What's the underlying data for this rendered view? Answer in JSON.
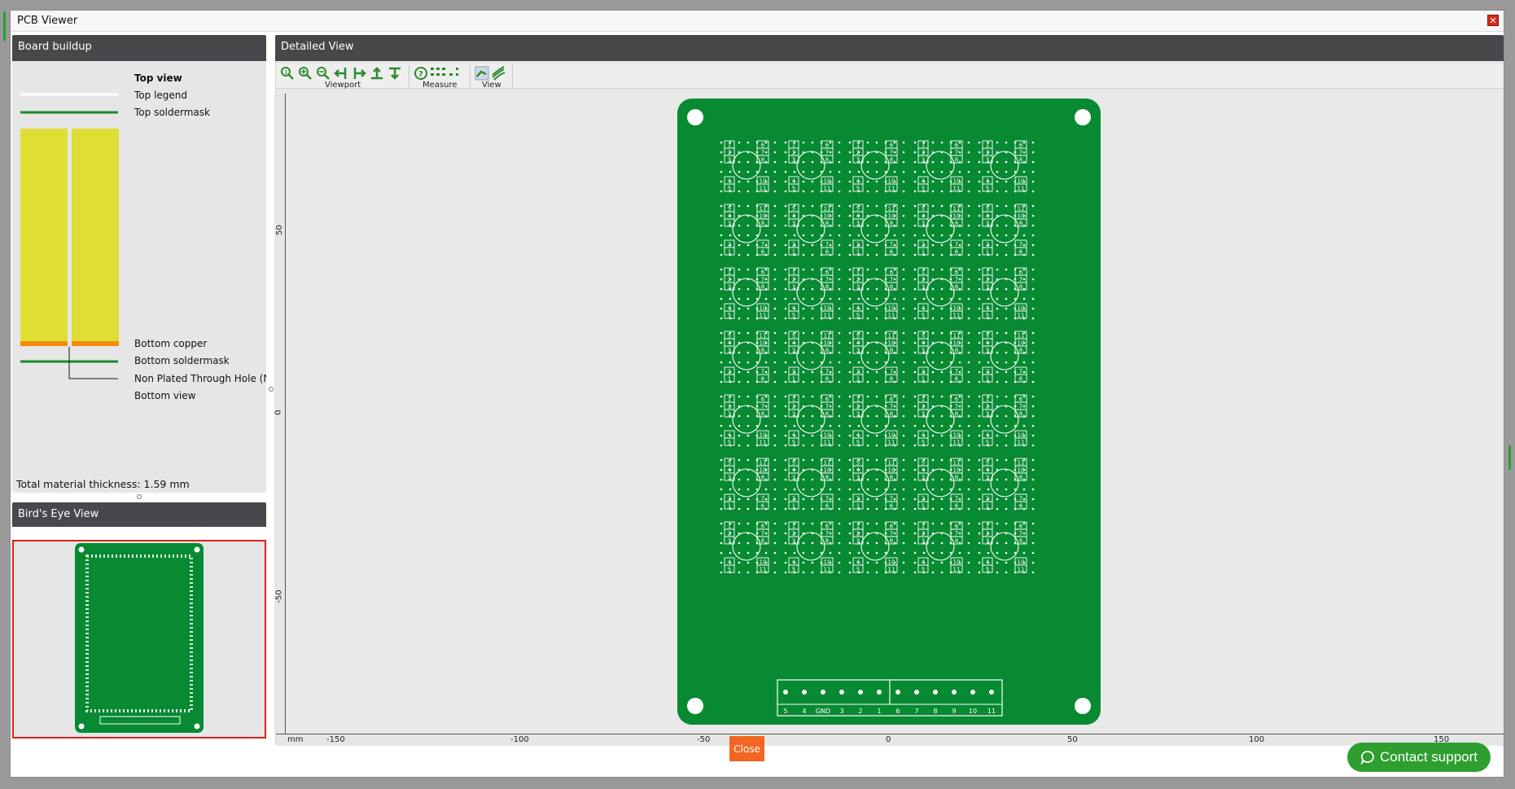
{
  "window": {
    "title": "PCB Viewer",
    "close_symbol": "✕"
  },
  "board_buildup": {
    "title": "Board buildup",
    "layers": {
      "top_view": "Top view",
      "top_legend": "Top legend",
      "top_soldermask": "Top soldermask",
      "bottom_copper": "Bottom copper",
      "bottom_soldermask": "Bottom soldermask",
      "nph": "Non Plated Through Hole (NPTH)",
      "bottom_view": "Bottom view"
    },
    "thickness": "Total material thickness: 1.59 mm"
  },
  "birds_eye": {
    "title": "Bird's Eye View"
  },
  "detailed_view": {
    "title": "Detailed View",
    "toolbar": {
      "viewport": "Viewport",
      "measure": "Measure",
      "view": "View"
    },
    "ruler_x": {
      "unit": "mm",
      "ticks": [
        "-150",
        "-100",
        "-50",
        "0",
        "50",
        "100",
        "150"
      ]
    },
    "ruler_y": {
      "ticks": [
        "50",
        "0",
        "-50"
      ]
    }
  },
  "board": {
    "pin_set_top": [
      "1",
      "2",
      "3",
      "4",
      "5"
    ],
    "pin_set_top_r": [
      "6",
      "7",
      "8",
      "10",
      "11"
    ],
    "pin_set_bot": [
      "5",
      "4",
      "3",
      "2",
      "1"
    ],
    "pin_set_bot_r": [
      "11",
      "10",
      "8",
      "7",
      "6"
    ],
    "connector_labels": [
      "5",
      "4",
      "GND",
      "3",
      "2",
      "1",
      "6",
      "7",
      "8",
      "9",
      "10",
      "11"
    ]
  },
  "colors": {
    "pcb_green": "#078a32",
    "legend_white": "#ffffff",
    "copper": "#f58a0c",
    "core_yellow": "#dede34",
    "soldermask": "#1a8a2c"
  },
  "footer": {
    "close": "Close",
    "support": "Contact support"
  }
}
